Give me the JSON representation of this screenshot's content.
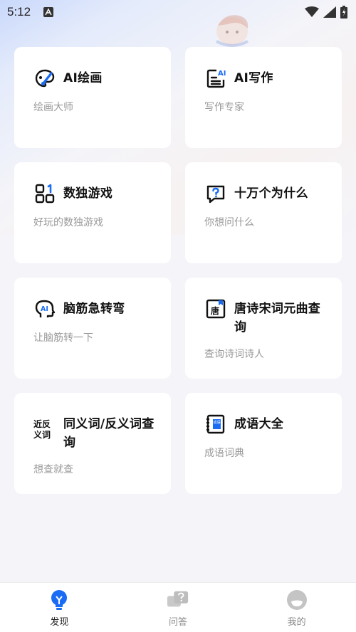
{
  "status_bar": {
    "time": "5:12"
  },
  "cards": [
    {
      "title": "AI绘画",
      "desc": "绘画大师",
      "icon": "palette-brush-icon"
    },
    {
      "title": "AI写作",
      "desc": "写作专家",
      "icon": "document-ai-icon"
    },
    {
      "title": "数独游戏",
      "desc": "好玩的数独游戏",
      "icon": "sudoku-grid-icon"
    },
    {
      "title": "十万个为什么",
      "desc": "你想问什么",
      "icon": "question-bubble-icon"
    },
    {
      "title": "脑筋急转弯",
      "desc": "让脑筋转一下",
      "icon": "brain-ai-icon"
    },
    {
      "title": "唐诗宋词元曲查询",
      "desc": "查询诗词诗人",
      "icon": "tang-book-icon",
      "icon_text": "唐"
    },
    {
      "title": "同义词/反义词查询",
      "desc": "想查就查",
      "icon": "synonym-antonym-icon",
      "icon_text_top": "近反",
      "icon_text_bottom": "义词"
    },
    {
      "title": "成语大全",
      "desc": "成语词典",
      "icon": "idiom-book-icon",
      "icon_text": "成语"
    }
  ],
  "tab_bar": {
    "tabs": [
      {
        "label": "发现",
        "icon": "lightbulb-icon",
        "active": true
      },
      {
        "label": "问答",
        "icon": "chat-question-icon",
        "active": false
      },
      {
        "label": "我的",
        "icon": "profile-icon",
        "active": false
      }
    ]
  },
  "colors": {
    "accent": "#1a6cf5",
    "card_bg": "#ffffff",
    "desc_text": "#999999"
  }
}
